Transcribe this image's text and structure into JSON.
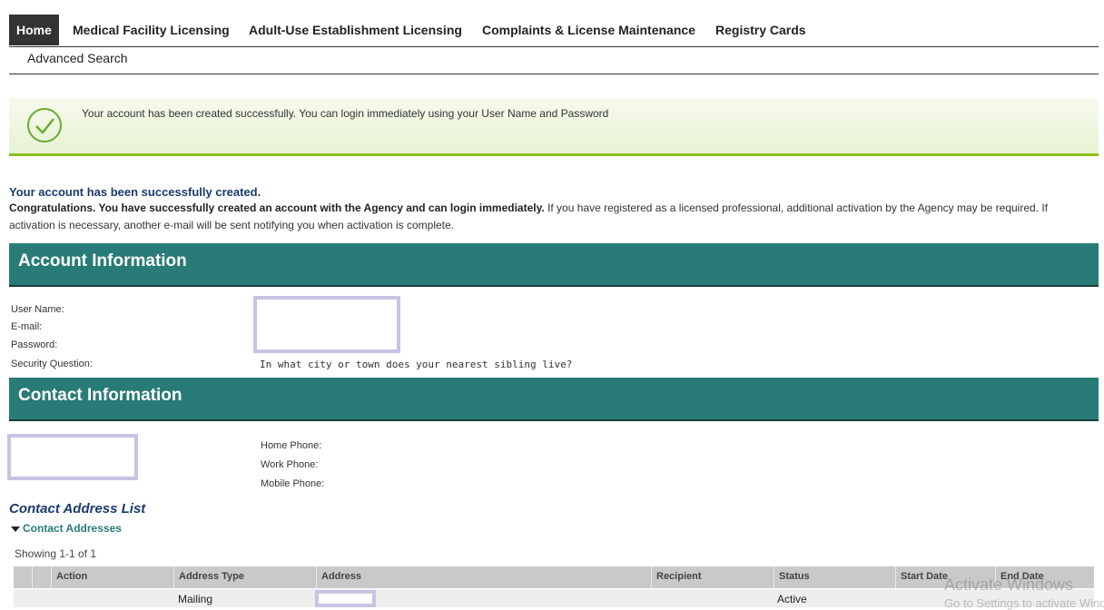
{
  "nav": {
    "tabs": [
      {
        "label": "Home",
        "active": true
      },
      {
        "label": "Medical Facility Licensing"
      },
      {
        "label": "Adult-Use Establishment Licensing"
      },
      {
        "label": "Complaints & License Maintenance"
      },
      {
        "label": "Registry Cards"
      }
    ],
    "sub": "Advanced Search"
  },
  "banner": {
    "icon": "check-circle-icon",
    "message": "Your account has been created successfully.  You can login immediately using your User Name and Password",
    "accent": "#8bc11a"
  },
  "created": {
    "title": "Your account has been successfully created.",
    "bold": "Congratulations. You have successfully created an account with the Agency and can login immediately.",
    "text": "  If you have registered as a licensed professional, additional activation by the Agency may be required. If activation is necessary, another e-mail will be sent notifying you when activation is complete."
  },
  "account": {
    "title": "Account Information",
    "labels": {
      "username": "User Name:",
      "email": "E-mail:",
      "password": "Password:",
      "security": "Security Question:"
    },
    "security_question": "In what city or town does your nearest sibling live?"
  },
  "contact": {
    "title": "Contact Information",
    "phones": {
      "home": "Home Phone:",
      "work": "Work Phone:",
      "mobile": "Mobile Phone:"
    }
  },
  "addresses": {
    "title": "Contact Address List",
    "toggle": "Contact Addresses",
    "showing": "Showing 1-1 of 1",
    "columns": [
      "Action",
      "Address Type",
      "Address",
      "Recipient",
      "Status",
      "Start Date",
      "End Date"
    ],
    "rows": [
      {
        "type": "Mailing",
        "status": "Active"
      }
    ]
  },
  "watermark": {
    "line1": "Activate Windows",
    "line2": "Go to Settings to activate Windows."
  },
  "colors": {
    "section": "#287b76",
    "title_blue": "#1a3b6d"
  }
}
